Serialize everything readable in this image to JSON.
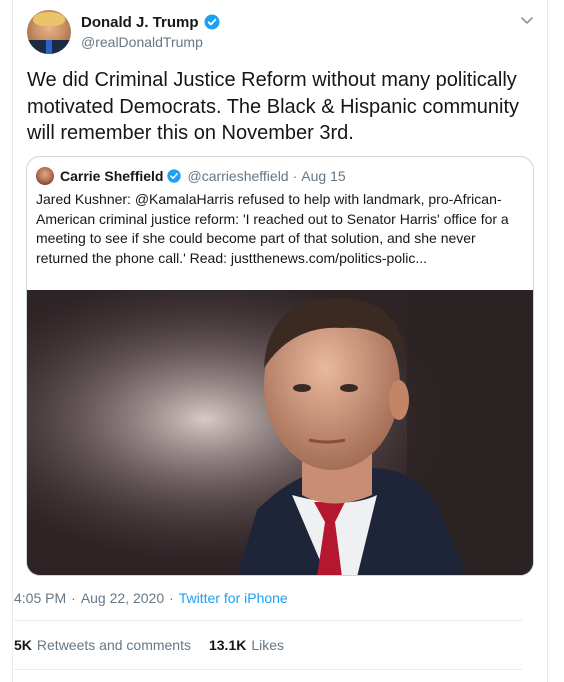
{
  "tweet": {
    "author_name": "Donald J. Trump",
    "author_handle": "@realDonaldTrump",
    "text": "We did Criminal Justice Reform without many politically motivated Democrats. The Black & Hispanic community will remember this on November 3rd.",
    "time": "4:05 PM",
    "separator": "·",
    "date": "Aug 22, 2020",
    "source": "Twitter for iPhone"
  },
  "quoted": {
    "author_name": "Carrie Sheffield",
    "author_handle": "@carriesheffield",
    "separator": "·",
    "date": "Aug 15",
    "text": "Jared Kushner: @KamalaHarris refused to help with landmark, pro-African-American criminal justice reform: 'I reached out to Senator Harris' office for a meeting to see if she could become part of that solution, and she never returned the phone call.' Read: justthenews.com/politics-polic..."
  },
  "stats": {
    "retweets_count": "5K",
    "retweets_label": "Retweets and comments",
    "likes_count": "13.1K",
    "likes_label": "Likes"
  },
  "colors": {
    "accent": "#1da1f2",
    "muted": "#657786",
    "text": "#14171a",
    "border": "#e6ecf0"
  },
  "icons": {
    "verified": "verified-badge-icon",
    "caret": "chevron-down-icon"
  }
}
